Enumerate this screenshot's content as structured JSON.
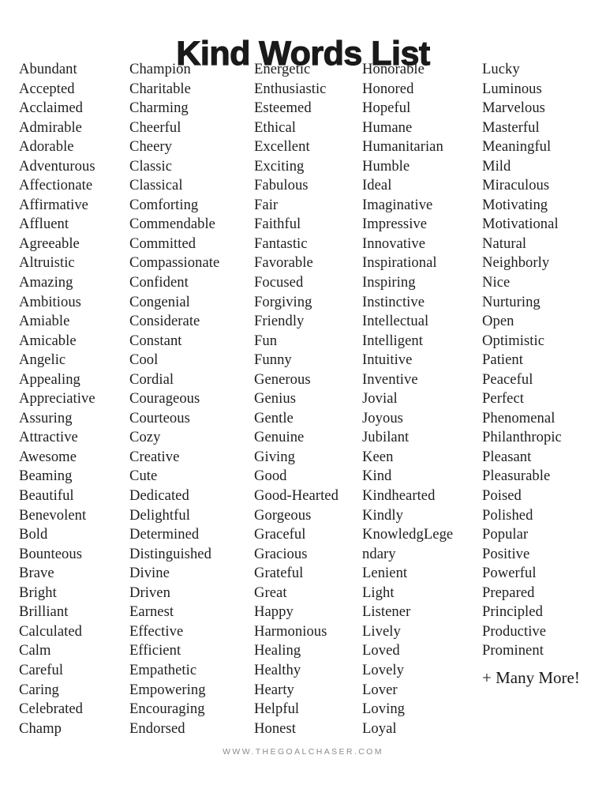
{
  "document": {
    "title": "Kind Words List",
    "footer": "WWW.THEGOALCHASER.COM",
    "closing_note": "+ Many More!",
    "colors": {
      "background": "#ffffff",
      "title_text": "#1a1a1a",
      "body_text": "#1f1f1f",
      "footer_text": "#8b8b8b"
    }
  },
  "columns": [
    {
      "index": 1,
      "words": [
        "Abundant",
        "Accepted",
        "Acclaimed",
        "Admirable",
        "Adorable",
        "Adventurous",
        "Affectionate",
        "Affirmative",
        "Affluent",
        "Agreeable",
        "Altruistic",
        "Amazing",
        "Ambitious",
        "Amiable",
        "Amicable",
        "Angelic",
        "Appealing",
        "Appreciative",
        "Assuring",
        "Attractive",
        "Awesome",
        "Beaming",
        "Beautiful",
        "Benevolent",
        "Bold",
        "Bounteous",
        "Brave",
        "Bright",
        "Brilliant",
        "Calculated",
        "Calm",
        "Careful",
        "Caring",
        "Celebrated",
        "Champ"
      ]
    },
    {
      "index": 2,
      "words": [
        "Champion",
        "Charitable",
        "Charming",
        "Cheerful",
        "Cheery",
        "Classic",
        "Classical",
        "Comforting",
        "Commendable",
        "Committed",
        "Compassionate",
        "Confident",
        "Congenial",
        "Considerate",
        "Constant",
        "Cool",
        "Cordial",
        "Courageous",
        "Courteous",
        "Cozy",
        "Creative",
        "Cute",
        "Dedicated",
        "Delightful",
        "Determined",
        "Distinguished",
        "Divine",
        "Driven",
        "Earnest",
        "Effective",
        "Efficient",
        "Empathetic",
        "Empowering",
        "Encouraging",
        "Endorsed"
      ]
    },
    {
      "index": 3,
      "words": [
        "Energetic",
        "Enthusiastic",
        "Esteemed",
        "Ethical",
        "Excellent",
        "Exciting",
        "Fabulous",
        "Fair",
        "Faithful",
        "Fantastic",
        "Favorable",
        "Focused",
        "Forgiving",
        "Friendly",
        "Fun",
        "Funny",
        "Generous",
        "Genius",
        "Gentle",
        "Genuine",
        "Giving",
        "Good",
        "Good-Hearted",
        "Gorgeous",
        "Graceful",
        "Gracious",
        "Grateful",
        "Great",
        "Happy",
        "Harmonious",
        "Healing",
        "Healthy",
        "Hearty",
        "Helpful",
        "Honest"
      ]
    },
    {
      "index": 4,
      "words": [
        "Honorable",
        "Honored",
        "Hopeful",
        "Humane",
        "Humanitarian",
        "Humble",
        "Ideal",
        "Imaginative",
        "Impressive",
        "Innovative",
        "Inspirational",
        "Inspiring",
        "Instinctive",
        "Intellectual",
        "Intelligent",
        "Intuitive",
        "Inventive",
        "Jovial",
        "Joyous",
        "Jubilant",
        "Keen",
        "Kind",
        "Kindhearted",
        "Kindly",
        "KnowledgLege",
        "ndary",
        "Lenient",
        "Light",
        "Listener",
        "Lively",
        "Loved",
        "Lovely",
        "Lover",
        "Loving",
        "Loyal"
      ]
    },
    {
      "index": 5,
      "words": [
        "Lucky",
        "Luminous",
        "Marvelous",
        "Masterful",
        "Meaningful",
        "Mild",
        "Miraculous",
        "Motivating",
        "Motivational",
        "Natural",
        "Neighborly",
        "Nice",
        "Nurturing",
        "Open",
        "Optimistic",
        "Patient",
        "Peaceful",
        "Perfect",
        "Phenomenal",
        "Philanthropic",
        "Pleasant",
        "Pleasurable",
        "Poised",
        "Polished",
        "Popular",
        "Positive",
        "Powerful",
        "Prepared",
        "Principled",
        "Productive",
        "Prominent"
      ]
    }
  ]
}
